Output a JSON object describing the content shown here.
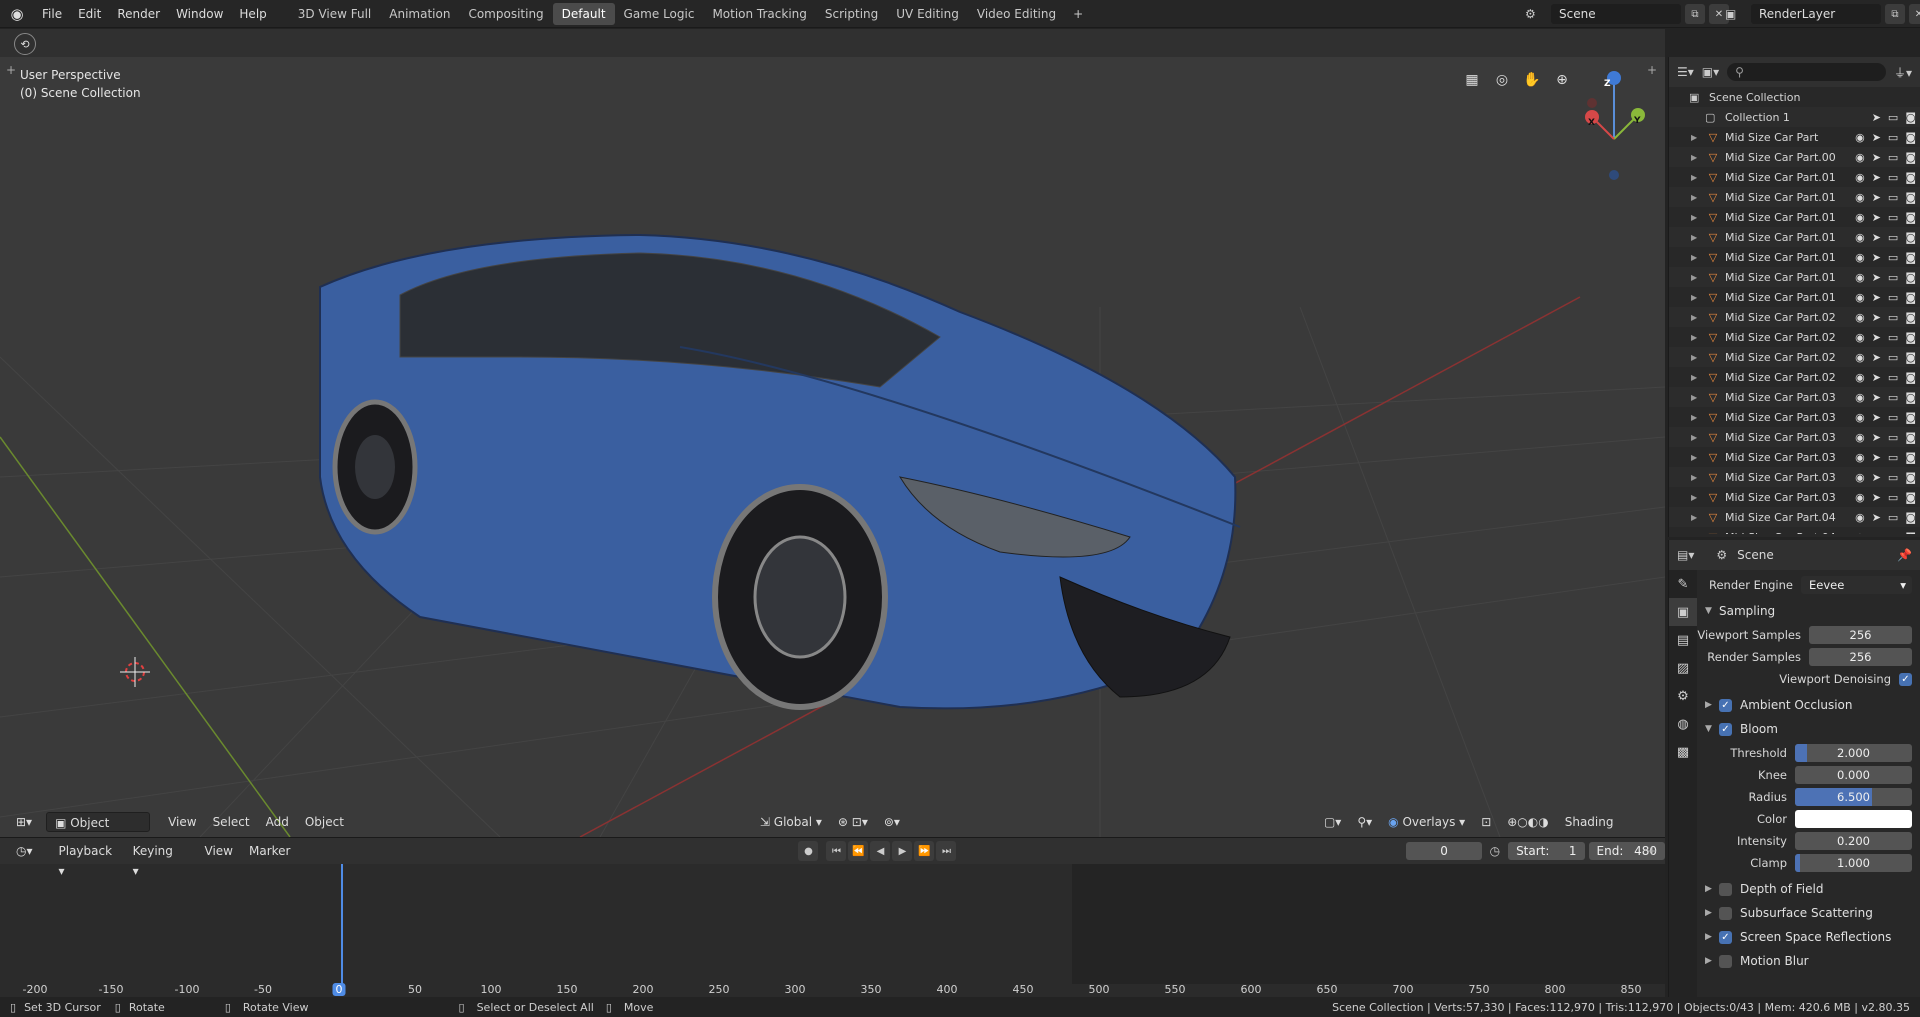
{
  "menu": [
    "File",
    "Edit",
    "Render",
    "Window",
    "Help"
  ],
  "workspaces": [
    "3D View Full",
    "Animation",
    "Compositing",
    "Default",
    "Game Logic",
    "Motion Tracking",
    "Scripting",
    "UV Editing",
    "Video Editing"
  ],
  "active_workspace": "Default",
  "scene_name": "Scene",
  "render_layer": "RenderLayer",
  "viewport": {
    "perspective_label": "User Perspective",
    "collection_label": "(0) Scene Collection",
    "mode": "Object Mode",
    "menus": [
      "View",
      "Select",
      "Add",
      "Object"
    ],
    "transform_orientation": "Global",
    "overlays": "Overlays",
    "shading": "Shading",
    "gizmo_axes": {
      "x": "X",
      "y": "Y",
      "z": "Z"
    }
  },
  "timeline": {
    "menus": [
      "Playback",
      "Keying",
      "View",
      "Marker"
    ],
    "current_frame": "0",
    "start_label": "Start:",
    "start": "1",
    "end_label": "End:",
    "end": "480",
    "ruler": [
      "-200",
      "-150",
      "-100",
      "-50",
      "0",
      "50",
      "100",
      "150",
      "200",
      "250",
      "300",
      "350",
      "400",
      "450",
      "500",
      "550",
      "600",
      "650",
      "700",
      "750",
      "800",
      "850"
    ]
  },
  "status": {
    "set_cursor": "Set 3D Cursor",
    "rotate": "Rotate",
    "rotate_view": "Rotate View",
    "select": "Select or Deselect All",
    "move": "Move",
    "stats": "Scene Collection | Verts:57,330 | Faces:112,970 | Tris:112,970 | Objects:0/43 | Mem: 420.6 MB | v2.80.35"
  },
  "outliner": {
    "root": "Scene Collection",
    "collection": "Collection 1",
    "items": [
      "Mid Size Car Part",
      "Mid Size Car Part.00",
      "Mid Size Car Part.01",
      "Mid Size Car Part.01",
      "Mid Size Car Part.01",
      "Mid Size Car Part.01",
      "Mid Size Car Part.01",
      "Mid Size Car Part.01",
      "Mid Size Car Part.01",
      "Mid Size Car Part.02",
      "Mid Size Car Part.02",
      "Mid Size Car Part.02",
      "Mid Size Car Part.02",
      "Mid Size Car Part.03",
      "Mid Size Car Part.03",
      "Mid Size Car Part.03",
      "Mid Size Car Part.03",
      "Mid Size Car Part.03",
      "Mid Size Car Part.03",
      "Mid Size Car Part.04",
      "Mid Size Car Part.04"
    ]
  },
  "properties": {
    "context": "Scene",
    "render_engine_label": "Render Engine",
    "render_engine": "Eevee",
    "sampling": "Sampling",
    "viewport_samples_label": "Viewport Samples",
    "viewport_samples": "256",
    "render_samples_label": "Render Samples",
    "render_samples": "256",
    "viewport_denoising": "Viewport Denoising",
    "ambient_occlusion": "Ambient Occlusion",
    "bloom": "Bloom",
    "threshold_label": "Threshold",
    "threshold": "2.000",
    "threshold_fill": 0.1,
    "knee_label": "Knee",
    "knee": "0.000",
    "radius_label": "Radius",
    "radius": "6.500",
    "radius_fill": 0.66,
    "color_label": "Color",
    "intensity_label": "Intensity",
    "intensity": "0.200",
    "clamp_label": "Clamp",
    "clamp": "1.000",
    "clamp_fill": 0.04,
    "depth_of_field": "Depth of Field",
    "subsurface": "Subsurface Scattering",
    "ssr": "Screen Space Reflections",
    "motion_blur": "Motion Blur"
  }
}
